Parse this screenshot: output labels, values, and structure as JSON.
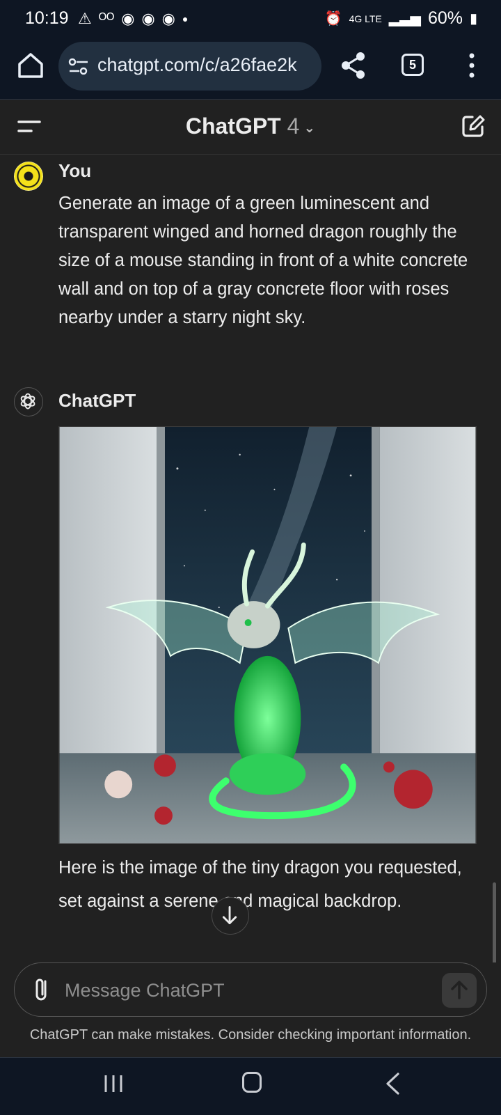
{
  "status_bar": {
    "time": "10:19",
    "icons": [
      "warning-icon",
      "voicemail-icon",
      "chrome-icon",
      "chrome-icon",
      "chrome-icon",
      "dot-icon"
    ],
    "network": "4G LTE",
    "battery": "60%"
  },
  "browser": {
    "url": "chatgpt.com/c/a26fae2k",
    "tab_count": "5"
  },
  "header": {
    "model_name": "ChatGPT",
    "model_version": "4"
  },
  "conversation": {
    "user": {
      "name": "You",
      "message": "Generate an image of a green luminescent and transparent winged and horned dragon roughly the size of a mouse standing in front of a white concrete wall and on top of a gray concrete floor with roses nearby under a starry night sky."
    },
    "assistant": {
      "name": "ChatGPT",
      "image_alt": "green luminescent winged dragon with roses",
      "message": "Here is the image of the tiny dragon you requested, set against a serene and magical backdrop."
    }
  },
  "composer": {
    "placeholder": "Message ChatGPT"
  },
  "disclaimer": "ChatGPT can make mistakes. Consider checking important information.",
  "colors": {
    "background": "#212121",
    "system_bar": "#0e1623",
    "dragon_glow": "#39e06a"
  }
}
